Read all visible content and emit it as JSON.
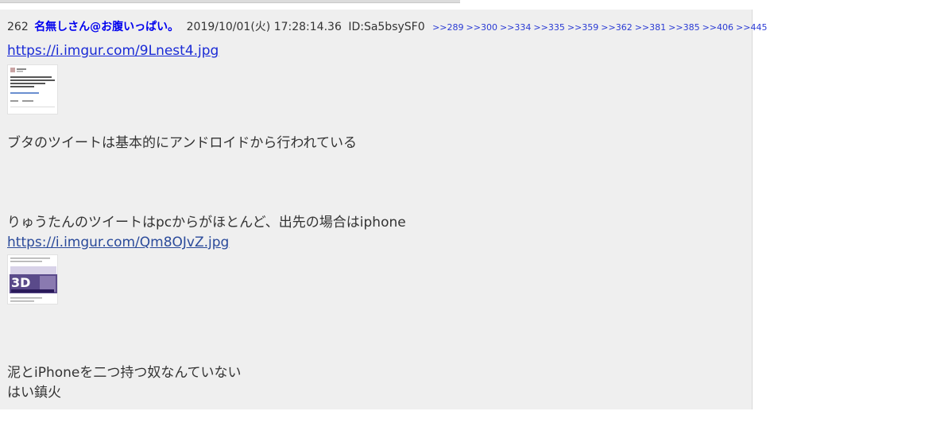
{
  "post": {
    "number": "262",
    "name": "名無しさん@お腹いっぱい。",
    "date": "2019/10/01(火) 17:28:14.36",
    "id": "ID:Sa5bsySF0",
    "replies": [
      ">>289",
      ">>300",
      ">>334",
      ">>335",
      ">>359",
      ">>362",
      ">>381",
      ">>385",
      ">>406",
      ">>445"
    ],
    "link1": "https://i.imgur.com/9Lnest4.jpg",
    "text1": "ブタのツイートは基本的にアンドロイドから行われている",
    "text2": "りゅうたんのツイートはpcからがほとんど、出先の場合はiphone",
    "link2": "https://i.imgur.com/Qm8OJvZ.jpg",
    "text3": "泥とiPhoneを二つ持つ奴なんていない",
    "text4": "はい鎮火"
  },
  "colors": {
    "post_bg": "#efefef",
    "name": "#0000ee",
    "anchor": "#2a3bd4",
    "link1": "#1a2bd6",
    "link2": "#2a4a9a",
    "text": "#333333"
  },
  "icons": {
    "thumb1": "tweet-screenshot-thumbnail",
    "thumb2": "tweet-image-3d-thumbnail"
  }
}
